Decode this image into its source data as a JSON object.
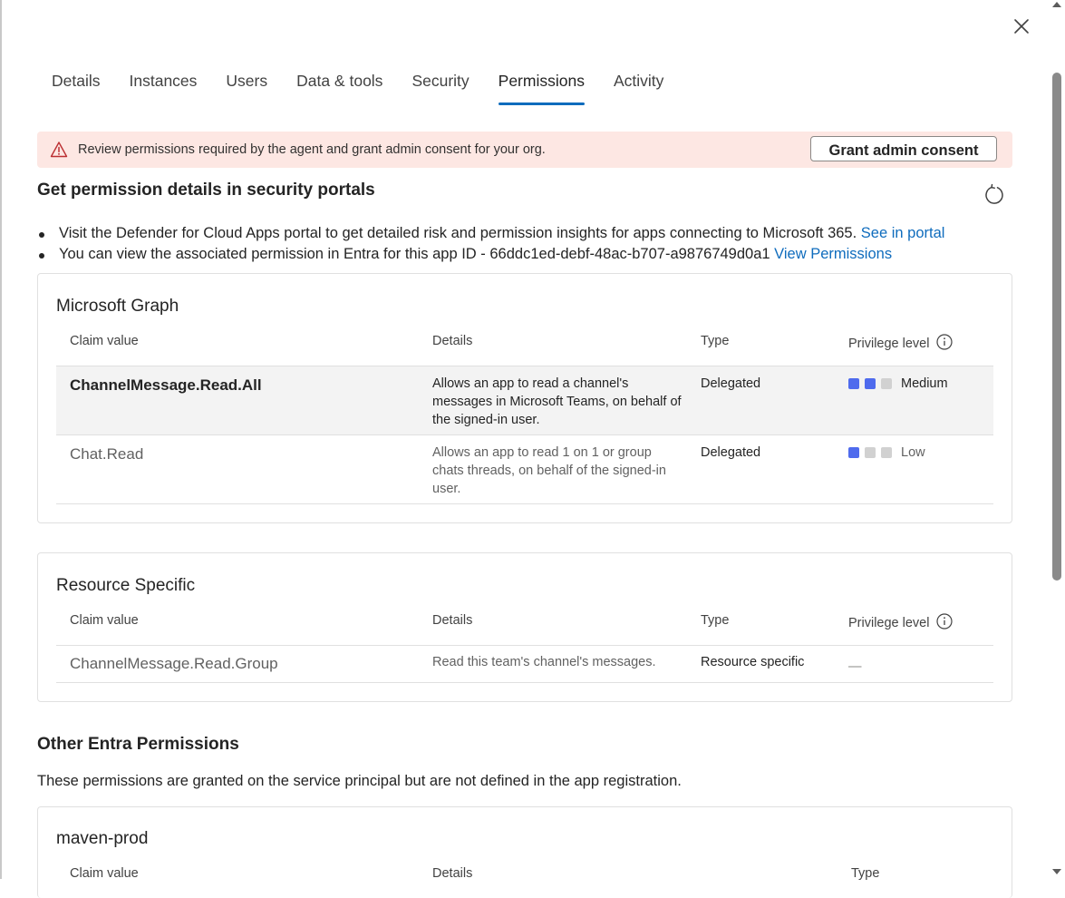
{
  "tabs": [
    {
      "label": "Details"
    },
    {
      "label": "Instances"
    },
    {
      "label": "Users"
    },
    {
      "label": "Data & tools"
    },
    {
      "label": "Security"
    },
    {
      "label": "Permissions",
      "active": true
    },
    {
      "label": "Activity"
    }
  ],
  "banner": {
    "icon": "warning-icon",
    "text": "Review permissions required by the agent and grant admin consent for your org.",
    "button_label": "Grant admin consent"
  },
  "portal_section": {
    "title": "Get permission details in security portals",
    "bullet1": {
      "text": "Visit the Defender for Cloud Apps portal to get detailed risk and permission insights for apps connecting to Microsoft 365.",
      "link": "See in portal"
    },
    "bullet2": {
      "text": "You can view the associated permission in Entra for this app ID - 66ddc1ed-debf-48ac-b707-a9876749d0a1",
      "link": "View Permissions"
    }
  },
  "columns": {
    "claim": "Claim value",
    "details": "Details",
    "type": "Type",
    "privilege": "Privilege level"
  },
  "graph": {
    "title": "Microsoft Graph",
    "rows": [
      {
        "claim": "ChannelMessage.Read.All",
        "details": "Allows an app to read a channel's messages in Microsoft Teams, on behalf of the signed-in user.",
        "type": "Delegated",
        "level": "Medium",
        "level_bars": 2
      },
      {
        "claim": "Chat.Read",
        "details": "Allows an app to read 1 on 1 or group chats threads, on behalf of the signed-in user.",
        "type": "Delegated",
        "level": "Low",
        "level_bars": 1
      }
    ]
  },
  "resource": {
    "title": "Resource Specific",
    "rows": [
      {
        "claim": "ChannelMessage.Read.Group",
        "details": "Read this team's channel's messages.",
        "type": "Resource specific",
        "level": "—"
      }
    ]
  },
  "other": {
    "title": "Other Entra Permissions",
    "description": "These permissions are granted on the service principal but are not defined in the app registration.",
    "card_title": "maven-prod"
  },
  "colors": {
    "accent": "#0f6cbd",
    "banner_bg": "#fde7e3",
    "warning": "#bc2f32",
    "level_on": "#4f6bed",
    "level_off": "#d1d1d1"
  }
}
